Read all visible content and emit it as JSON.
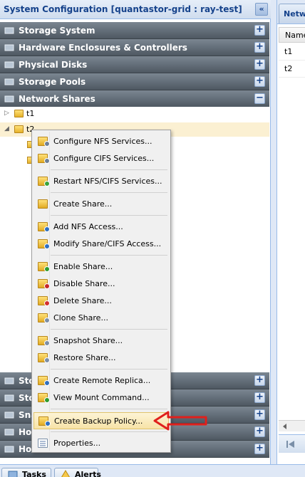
{
  "left_panel": {
    "title": "System Configuration [quantastor-grid : ray-test]",
    "collapse_button": "«",
    "sections_top": [
      {
        "label": "Storage System",
        "icon": "storage-system-icon",
        "button": "+"
      },
      {
        "label": "Hardware Enclosures & Controllers",
        "icon": "enclosure-icon",
        "button": "+"
      },
      {
        "label": "Physical Disks",
        "icon": "physical-disk-icon",
        "button": "+"
      },
      {
        "label": "Storage Pools",
        "icon": "storage-pool-icon",
        "button": "+"
      },
      {
        "label": "Network Shares",
        "icon": "network-share-icon",
        "button": "−"
      }
    ],
    "tree": [
      {
        "label": "t1",
        "expander": "▷"
      },
      {
        "label": "t2",
        "expander": "◢"
      }
    ],
    "sections_bottom": [
      {
        "label": "Sto",
        "icon": "storage-icon",
        "button": "+"
      },
      {
        "label": "Sto",
        "icon": "storage-icon",
        "button": "+"
      },
      {
        "label": "Sna",
        "icon": "snapshot-icon",
        "button": "+"
      },
      {
        "label": "Hos",
        "icon": "host-icon",
        "button": "+"
      },
      {
        "label": "Hos",
        "icon": "host-group-icon",
        "button": "+"
      }
    ]
  },
  "context_menu": {
    "items": [
      {
        "label": "Configure NFS Services...",
        "icon": "nfs-config-icon",
        "badge": "#6d7f98"
      },
      {
        "label": "Configure CIFS Services...",
        "icon": "cifs-config-icon",
        "badge": "#6d7f98"
      },
      {
        "label": "Restart NFS/CIFS Services...",
        "icon": "restart-icon",
        "badge": "#3aa33a"
      },
      {
        "label": "Create Share...",
        "icon": "create-share-icon",
        "badge": ""
      },
      {
        "label": "Add NFS Access...",
        "icon": "add-nfs-access-icon",
        "badge": "#2f6fc0"
      },
      {
        "label": "Modify Share/CIFS Access...",
        "icon": "modify-share-icon",
        "badge": "#2f6fc0"
      },
      {
        "label": "Enable Share...",
        "icon": "enable-share-icon",
        "badge": "#2e9b2e"
      },
      {
        "label": "Disable Share...",
        "icon": "disable-share-icon",
        "badge": "#c62828"
      },
      {
        "label": "Delete Share...",
        "icon": "delete-share-icon",
        "badge": "#d32f2f"
      },
      {
        "label": "Clone Share...",
        "icon": "clone-share-icon",
        "badge": "#7b8ea8"
      },
      {
        "label": "Snapshot Share...",
        "icon": "snapshot-share-icon",
        "badge": "#7b8ea8"
      },
      {
        "label": "Restore Share...",
        "icon": "restore-share-icon",
        "badge": "#7b8ea8"
      },
      {
        "label": "Create Remote Replica...",
        "icon": "remote-replica-icon",
        "badge": "#2f6fc0"
      },
      {
        "label": "View Mount Command...",
        "icon": "mount-command-icon",
        "badge": "#2e9b2e"
      },
      {
        "label": "Create Backup Policy...",
        "icon": "backup-policy-icon",
        "badge": "#2f6fc0"
      },
      {
        "label": "Properties...",
        "icon": "properties-icon",
        "badge": ""
      }
    ]
  },
  "right_panel": {
    "tab": "Netwo",
    "column_header": "Name",
    "rows": [
      "t1",
      "t2"
    ]
  },
  "bottom_tabs": [
    {
      "label": "Tasks",
      "icon": "tasks-icon"
    },
    {
      "label": "Alerts",
      "icon": "alerts-icon"
    }
  ],
  "colors": {
    "accordion_header": "#5a646e",
    "title_text": "#15428b",
    "highlight": "#f7e3a6",
    "arrow": "#e0201c"
  }
}
